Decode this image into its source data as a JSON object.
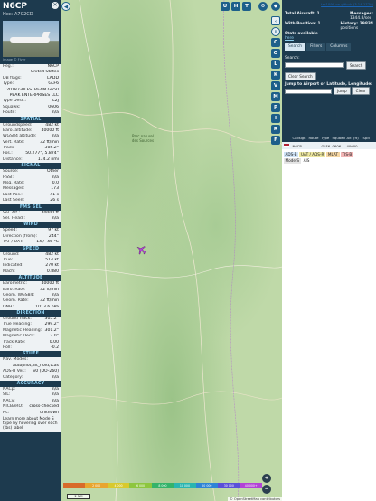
{
  "aircraft": {
    "callsign": "N6CP",
    "hex_label": "Hex: A7C2CD",
    "photo_credit": "Image © Flyer"
  },
  "details": [
    {
      "k": "Reg.:",
      "v": "N6CP"
    },
    {
      "k": "",
      "v": "United States"
    },
    {
      "k": "DB flags:",
      "v": "LADD"
    },
    {
      "k": "Type:",
      "v": "GLF6"
    },
    {
      "k": "",
      "v": "2018 GULFSTREAM G650"
    },
    {
      "k": "",
      "v": "PEAK ENTERPRISES LLC"
    },
    {
      "k": "Type Desc.:",
      "v": "L2J"
    },
    {
      "k": "Squawk:",
      "v": "0606"
    },
    {
      "k": "Route:",
      "v": "n/a"
    }
  ],
  "sections": {
    "spatial": "SPATIAL",
    "signal": "SIGNAL",
    "fms": "FMS SEL",
    "wind": "WIND",
    "speed": "SPEED",
    "altitude": "ALTITUDE",
    "direction": "DIRECTION",
    "stuff": "STUFF",
    "accuracy": "ACCURACY"
  },
  "spatial": [
    {
      "k": "Groundspeed:",
      "v": "482 kt"
    },
    {
      "k": "Baro. altitude:",
      "v": "40000 ft"
    },
    {
      "k": "WGS84 altitude:",
      "v": "n/a"
    },
    {
      "k": "Vert. Rate:",
      "v": "32 ft/min"
    },
    {
      "k": "Track:",
      "v": "305.2°"
    },
    {
      "k": "Pos.:",
      "v": "50.277°, 5.874°"
    },
    {
      "k": "Distance:",
      "v": "174.2 nmi"
    }
  ],
  "signal": [
    {
      "k": "Source:",
      "v": "Other"
    },
    {
      "k": "RSSI:",
      "v": "n/a"
    },
    {
      "k": "Msg. Rate:",
      "v": "0.0"
    },
    {
      "k": "Messages:",
      "v": "173"
    },
    {
      "k": "Last Pos.:",
      "v": "41 s"
    },
    {
      "k": "Last Seen:",
      "v": "26 s"
    }
  ],
  "fms": [
    {
      "k": "Sel. Alt.:",
      "v": "40000 ft"
    },
    {
      "k": "Sel. Head.:",
      "v": "n/a"
    }
  ],
  "wind": [
    {
      "k": "Speed:",
      "v": "97 kt"
    },
    {
      "k": "Direction (from):",
      "v": "244°"
    },
    {
      "k": "TAT / OAT:",
      "v": "-14 / -46 °C"
    }
  ],
  "speed": [
    {
      "k": "Ground:",
      "v": "482 kt"
    },
    {
      "k": "True:",
      "v": "514 kt"
    },
    {
      "k": "Indicated:",
      "v": "270 kt"
    },
    {
      "k": "Mach:",
      "v": "0.880"
    }
  ],
  "altitude": [
    {
      "k": "Barometric:",
      "v": "40000 ft"
    },
    {
      "k": "Baro. Rate:",
      "v": "32 ft/min"
    },
    {
      "k": "Geom. WGS84:",
      "v": "n/a"
    },
    {
      "k": "Geom. Rate:",
      "v": "32 ft/min"
    },
    {
      "k": "QNH:",
      "v": "1013.6 hPa"
    }
  ],
  "direction": [
    {
      "k": "Ground Track:",
      "v": "305.2°"
    },
    {
      "k": "True Heading:",
      "v": "299.2°"
    },
    {
      "k": "Magnetic Heading:",
      "v": "301.2°"
    },
    {
      "k": "Magnetic Decl.:",
      "v": "2.0°"
    },
    {
      "k": "Track Rate:",
      "v": "0.00"
    },
    {
      "k": "Roll:",
      "v": "-0.2"
    }
  ],
  "stuff": [
    {
      "k": "Nav. Modes:",
      "v": ""
    },
    {
      "k": "",
      "v": "autopilot,alt_hold,tcas"
    },
    {
      "k": "ADS-B Ver.:",
      "v": "v0 (DO-260)"
    },
    {
      "k": "Category:",
      "v": "n/a"
    }
  ],
  "accuracy": [
    {
      "k": "NACp:",
      "v": "n/a"
    },
    {
      "k": "SIL:",
      "v": "n/a"
    },
    {
      "k": "NACv:",
      "v": "n/a"
    },
    {
      "k": "NICBARO:",
      "v": "cross-checked"
    },
    {
      "k": "Rc:",
      "v": "unknown"
    }
  ],
  "footer_text": "Learn more about Mode S type by hovering over each (tbs) label",
  "map": {
    "label_parc": "Parc naturel\ndes Sources",
    "scale_label": "2 NM",
    "attribution": "© OpenStreetMap contributors",
    "colorbar": [
      "",
      "2 000",
      "4 000",
      "6 000",
      "8 000",
      "10 000",
      "20 000",
      "30 000",
      "40 000+"
    ],
    "controls_top": [
      "U",
      "H",
      "T"
    ],
    "controls_side": [
      "C",
      "O",
      "L",
      "K",
      "V",
      "M",
      "P",
      "I",
      "R",
      "F"
    ]
  },
  "right": {
    "github_link": "tar1090 on github (3.14.1770)",
    "total_label": "Total Aircraft: 1",
    "messages_label": "Messages:",
    "messages_value": "1344.8/sec",
    "withpos_label": "With Position: 1",
    "history_label": "History: 29834",
    "history_value": "positions",
    "stats_label": "Stats available",
    "stats_link": "here",
    "tabs": [
      "Search",
      "Filters",
      "Columns"
    ],
    "search_label": "Search:",
    "search_button": "Search",
    "clear_search": "Clear Search",
    "jump_label": "Jump to Airport or Latitude, Longitude:",
    "jump_button": "Jump",
    "clear_button": "Clear",
    "columns": [
      "",
      "Callsign",
      "Route",
      "Type",
      "Squawk",
      "Alt. (ft)",
      "Spd"
    ],
    "row": [
      "N6CP",
      "GLF6",
      "0606",
      "40000"
    ],
    "badges": [
      {
        "label": "ADS-B",
        "bg": "#cfe3f6"
      },
      {
        "label": "UAT / ADS-R",
        "bg": "#ece6a0"
      },
      {
        "label": "MLAT",
        "bg": "#f5d6a3"
      },
      {
        "label": "TIS-B",
        "bg": "#f2b6b6"
      }
    ],
    "badges2": [
      "Mode-S",
      "AIS"
    ]
  }
}
